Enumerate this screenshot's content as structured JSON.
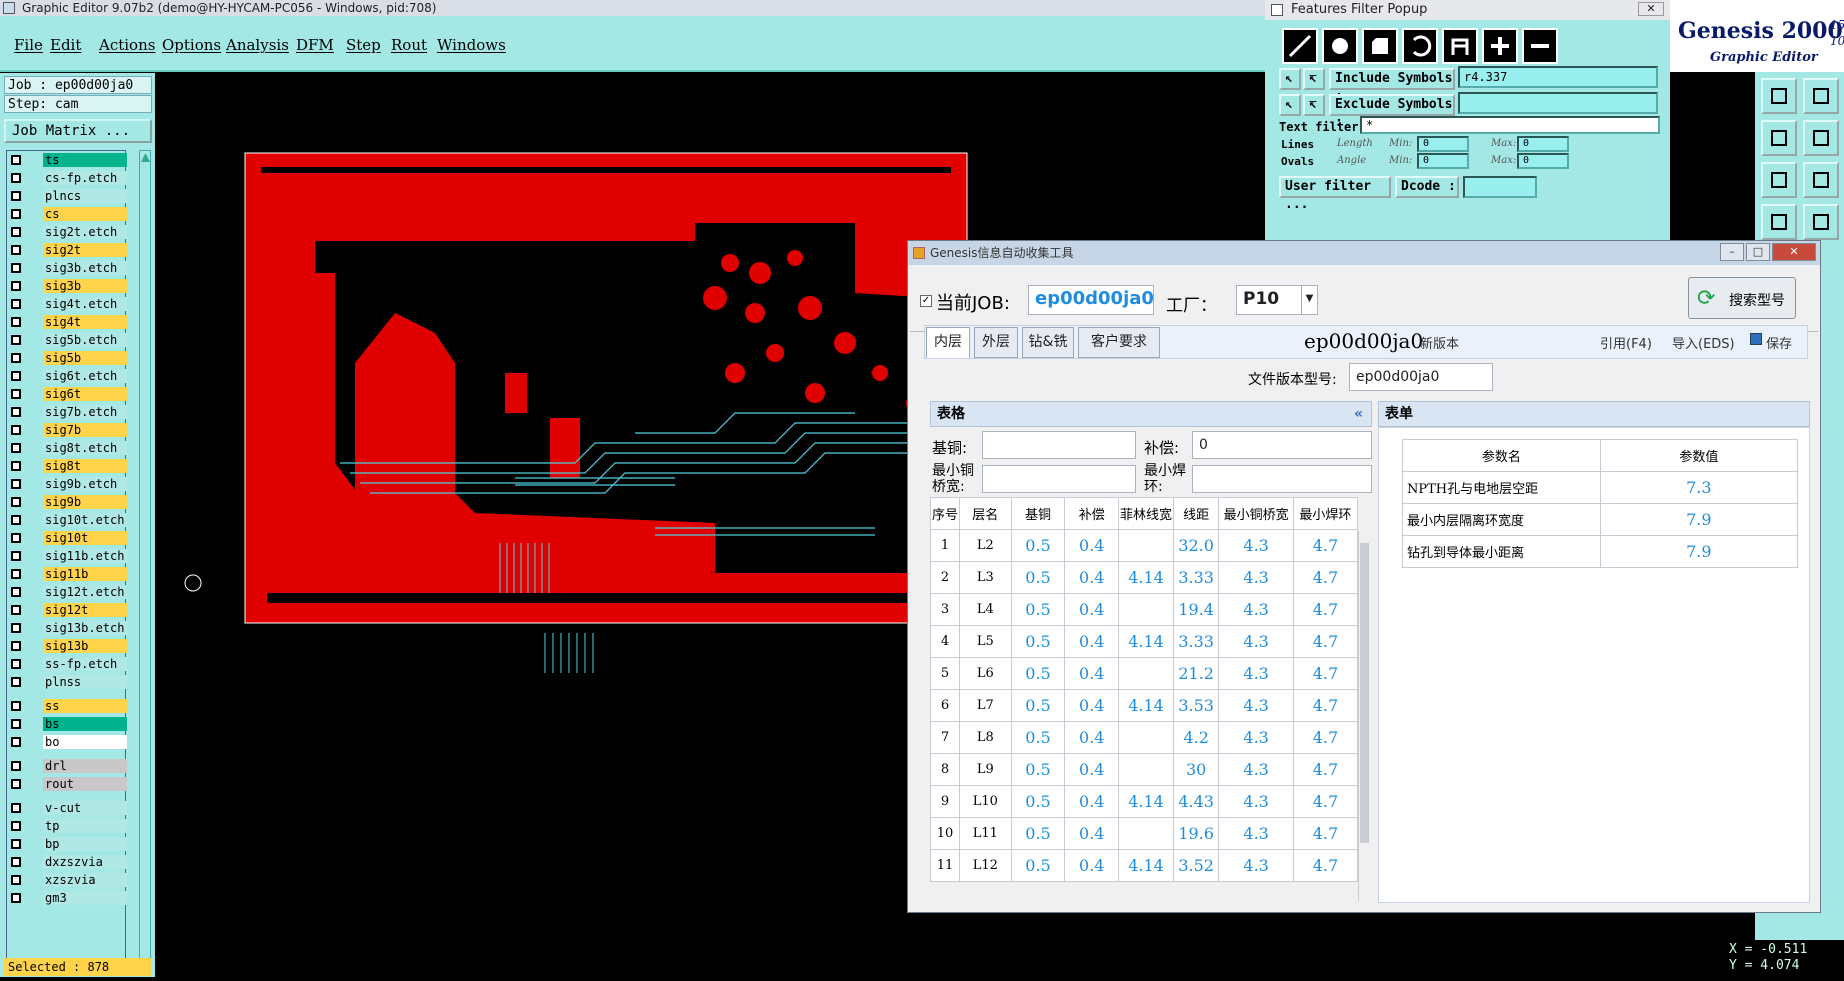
{
  "window_title": "Graphic Editor 9.07b2 (demo@HY-HYCAM-PC056 - Windows, pid:708)",
  "menu": [
    "File",
    "Edit",
    "Actions",
    "Options",
    "Analysis",
    "DFM",
    "Step",
    "Rout",
    "Windows"
  ],
  "job_label": "Job : ep00d00ja0",
  "step_label": "Step: cam",
  "job_matrix_label": "Job Matrix ...",
  "layers": [
    {
      "name": "ts",
      "color": "#00b38c"
    },
    {
      "name": "cs-fp.etch",
      "color": "#b0e8e6"
    },
    {
      "name": "plncs",
      "color": "#b0e8e6"
    },
    {
      "name": "cs",
      "color": "#ffd34a"
    },
    {
      "name": "sig2t.etch",
      "color": "#b0e8e6"
    },
    {
      "name": "sig2t",
      "color": "#ffd34a"
    },
    {
      "name": "sig3b.etch",
      "color": "#b0e8e6"
    },
    {
      "name": "sig3b",
      "color": "#ffd34a"
    },
    {
      "name": "sig4t.etch",
      "color": "#b0e8e6"
    },
    {
      "name": "sig4t",
      "color": "#ffd34a"
    },
    {
      "name": "sig5b.etch",
      "color": "#b0e8e6"
    },
    {
      "name": "sig5b",
      "color": "#ffd34a"
    },
    {
      "name": "sig6t.etch",
      "color": "#b0e8e6"
    },
    {
      "name": "sig6t",
      "color": "#ffd34a"
    },
    {
      "name": "sig7b.etch",
      "color": "#b0e8e6"
    },
    {
      "name": "sig7b",
      "color": "#ffd34a"
    },
    {
      "name": "sig8t.etch",
      "color": "#b0e8e6"
    },
    {
      "name": "sig8t",
      "color": "#ffd34a"
    },
    {
      "name": "sig9b.etch",
      "color": "#b0e8e6"
    },
    {
      "name": "sig9b",
      "color": "#ffd34a"
    },
    {
      "name": "sig10t.etch",
      "color": "#b0e8e6"
    },
    {
      "name": "sig10t",
      "color": "#ffd34a"
    },
    {
      "name": "sig11b.etch",
      "color": "#b0e8e6"
    },
    {
      "name": "sig11b",
      "color": "#ffd34a"
    },
    {
      "name": "sig12t.etch",
      "color": "#b0e8e6"
    },
    {
      "name": "sig12t",
      "color": "#ffd34a"
    },
    {
      "name": "sig13b.etch",
      "color": "#b0e8e6"
    },
    {
      "name": "sig13b",
      "color": "#ffd34a"
    },
    {
      "name": "ss-fp.etch",
      "color": "#b0e8e6"
    },
    {
      "name": "plnss",
      "color": "#b0e8e6"
    },
    {
      "name": "ss",
      "color": "#ffd34a"
    },
    {
      "name": "bs",
      "color": "#00b38c"
    },
    {
      "name": "bo",
      "color": "#ffffff"
    },
    {
      "name": "drl",
      "color": "#c8c8c8"
    },
    {
      "name": "rout",
      "color": "#c8c8c8"
    },
    {
      "name": "v-cut",
      "color": "#b0e8e6"
    },
    {
      "name": "tp",
      "color": "#b0e8e6"
    },
    {
      "name": "bp",
      "color": "#b0e8e6"
    },
    {
      "name": "dxzszvia",
      "color": "#b0e8e6"
    },
    {
      "name": "xzszvia",
      "color": "#b0e8e6"
    },
    {
      "name": "gm3",
      "color": "#b0e8e6"
    }
  ],
  "selected_label": "Selected : 878",
  "ffp": {
    "title": "Features Filter Popup",
    "include_label": "Include Symbols :",
    "include_value": "r4.337",
    "exclude_label": "Exclude Symbols :",
    "text_filter_label": "Text filter",
    "text_filter_value": "*",
    "lines": "Lines",
    "ovals": "Ovals",
    "length": "Length",
    "angle": "Angle",
    "min1": "Min:",
    "max1": "Max:",
    "min2": "Min:",
    "max2": "Max:",
    "min_val": "0",
    "max_val": "0",
    "user_filter": "User filter ...",
    "dcode": "Dcode :"
  },
  "genesis": {
    "title": "Genesis 2000",
    "subtitle": "Graphic Editor",
    "ver_a": "15",
    "ver_b": "10"
  },
  "coords": {
    "x": "X = -0.511",
    "y": "Y = 4.074"
  },
  "dlg": {
    "title": "Genesis信息自动收集工具",
    "job_label": "当前JOB:",
    "job_value": "ep00d00ja0",
    "factory_label": "工厂：",
    "factory_value": "P10",
    "search_btn": "搜索型号",
    "tabs": [
      "内层",
      "外层",
      "钻&铣",
      "客户要求"
    ],
    "big_job": "ep00d00ja0",
    "new_version": "新版本",
    "cite": "引用(F4)",
    "import": "导入(EDS)",
    "save": "保存",
    "file_version_label": "文件版本型号:",
    "file_version_value": "ep00d00ja0",
    "grid_header": "表格",
    "form_header": "表单",
    "base_cu_label": "基铜:",
    "comp_label": "补偿:",
    "comp_value": "0",
    "min_bridge_label": "最小铜桥宽:",
    "min_ring_label": "最小焊环:",
    "grid_cols": [
      "序号",
      "层名",
      "基铜",
      "补偿",
      "菲林线宽",
      "线距",
      "最小铜桥宽",
      "最小焊环"
    ],
    "grid_rows": [
      [
        "1",
        "L2",
        "0.5",
        "0.4",
        "",
        "32.0",
        "4.3",
        "4.7"
      ],
      [
        "2",
        "L3",
        "0.5",
        "0.4",
        "4.14",
        "3.33",
        "4.3",
        "4.7"
      ],
      [
        "3",
        "L4",
        "0.5",
        "0.4",
        "",
        "19.4",
        "4.3",
        "4.7"
      ],
      [
        "4",
        "L5",
        "0.5",
        "0.4",
        "4.14",
        "3.33",
        "4.3",
        "4.7"
      ],
      [
        "5",
        "L6",
        "0.5",
        "0.4",
        "",
        "21.2",
        "4.3",
        "4.7"
      ],
      [
        "6",
        "L7",
        "0.5",
        "0.4",
        "4.14",
        "3.53",
        "4.3",
        "4.7"
      ],
      [
        "7",
        "L8",
        "0.5",
        "0.4",
        "",
        "4.2",
        "4.3",
        "4.7"
      ],
      [
        "8",
        "L9",
        "0.5",
        "0.4",
        "",
        "30",
        "4.3",
        "4.7"
      ],
      [
        "9",
        "L10",
        "0.5",
        "0.4",
        "4.14",
        "4.43",
        "4.3",
        "4.7"
      ],
      [
        "10",
        "L11",
        "0.5",
        "0.4",
        "",
        "19.6",
        "4.3",
        "4.7"
      ],
      [
        "11",
        "L12",
        "0.5",
        "0.4",
        "4.14",
        "3.52",
        "4.3",
        "4.7"
      ]
    ],
    "form_cols": [
      "参数名",
      "参数值"
    ],
    "form_rows": [
      [
        "NPTH孔与电地层空距",
        "7.3"
      ],
      [
        "最小内层隔离环宽度",
        "7.9"
      ],
      [
        "钻孔到导体最小距离",
        "7.9"
      ]
    ]
  }
}
